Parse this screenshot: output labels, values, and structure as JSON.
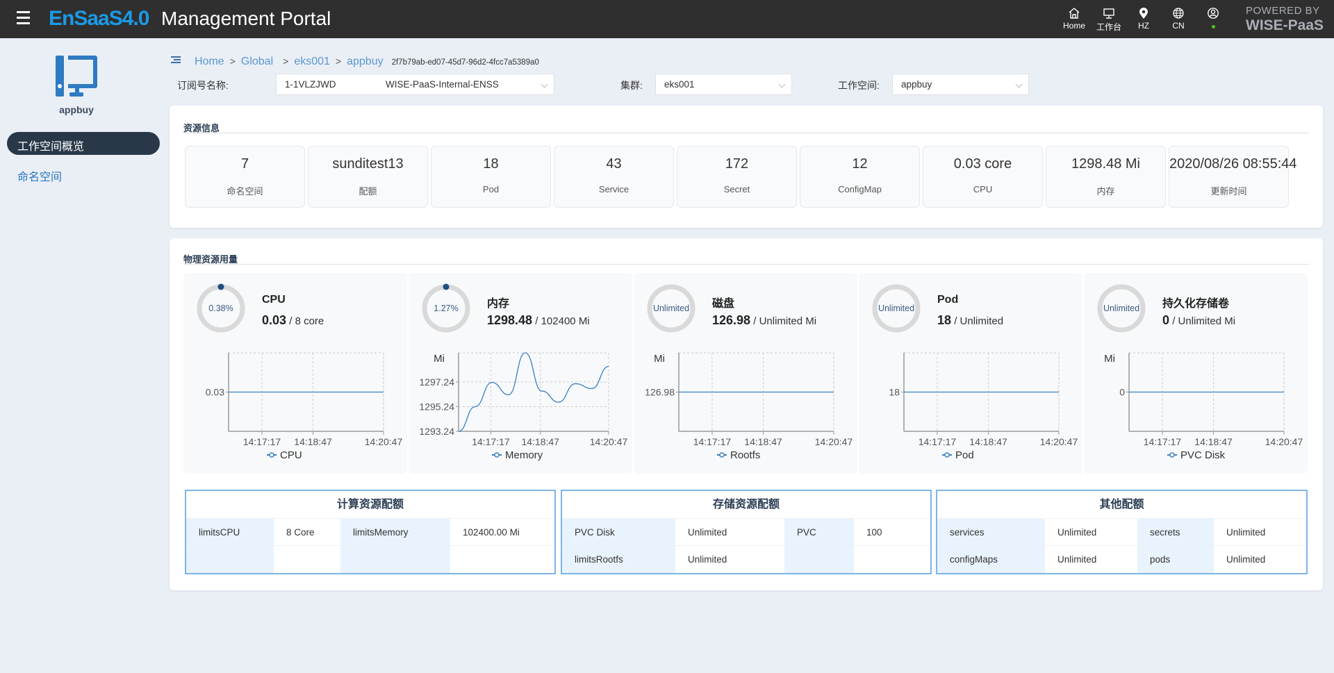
{
  "header": {
    "menu_icon": "hamburger-icon",
    "brand": "EnSaaS4.0",
    "title": "Management Portal",
    "nav": [
      {
        "icon": "home-icon",
        "label": "Home"
      },
      {
        "icon": "monitor-icon",
        "label": "工作台"
      },
      {
        "icon": "location-icon",
        "label": "HZ"
      },
      {
        "icon": "globe-icon",
        "label": "CN"
      },
      {
        "icon": "user-icon",
        "label": ""
      }
    ],
    "user_status_color": "#52c41a",
    "powered_by": "POWERED BY",
    "powered_brand": "WISE-PaaS"
  },
  "sidebar": {
    "workspace_icon": "computer-icon",
    "workspace_name": "appbuy",
    "items": [
      {
        "label": "工作空间概览",
        "active": true
      },
      {
        "label": "命名空间",
        "active": false
      }
    ]
  },
  "breadcrumb": {
    "items": [
      "Home",
      "Global",
      "eks001",
      "appbuy"
    ],
    "separator": ">",
    "uuid": "2f7b79ab-ed07-45d7-96d2-4fcc7a5389a0"
  },
  "filters": {
    "subscription": {
      "label": "订阅号名称:",
      "id": "1-1VLZJWD",
      "name": "WISE-PaaS-Internal-ENSS"
    },
    "cluster": {
      "label": "集群:",
      "value": "eks001"
    },
    "workspace": {
      "label": "工作空间:",
      "value": "appbuy"
    }
  },
  "resource_info": {
    "title": "资源信息",
    "stats": [
      {
        "value": "7",
        "label": "命名空间"
      },
      {
        "value": "sunditest13",
        "label": "配额"
      },
      {
        "value": "18",
        "label": "Pod"
      },
      {
        "value": "43",
        "label": "Service"
      },
      {
        "value": "172",
        "label": "Secret"
      },
      {
        "value": "12",
        "label": "ConfigMap"
      },
      {
        "value": "0.03 core",
        "label": "CPU"
      },
      {
        "value": "1298.48 Mi",
        "label": "内存"
      },
      {
        "value": "2020/08/26 08:55:44",
        "label": "更新时间"
      }
    ]
  },
  "physical_usage": {
    "title": "物理资源用量",
    "panels": [
      {
        "ring_label": "0.38%",
        "percent": 0.38,
        "title": "CPU",
        "used": "0.03",
        "total": "8 core"
      },
      {
        "ring_label": "1.27%",
        "percent": 1.27,
        "title": "内存",
        "used": "1298.48",
        "total": "102400 Mi"
      },
      {
        "ring_label": "Unlimited",
        "percent": null,
        "title": "磁盘",
        "used": "126.98",
        "total": "Unlimited Mi"
      },
      {
        "ring_label": "Unlimited",
        "percent": null,
        "title": "Pod",
        "used": "18",
        "total": "Unlimited"
      },
      {
        "ring_label": "Unlimited",
        "percent": null,
        "title": "持久化存储卷",
        "used": "0",
        "total": "Unlimited Mi"
      }
    ]
  },
  "chart_data": [
    {
      "type": "line",
      "title": "",
      "xlabel": "",
      "ylabel": "",
      "x_ticks": [
        "14:17:17",
        "14:18:47",
        "14:20:47"
      ],
      "y_ticks": [
        "0.03"
      ],
      "ylim": [
        0,
        0.06
      ],
      "series": [
        {
          "name": "CPU",
          "values": [
            0.03,
            0.03,
            0.03,
            0.03,
            0.03,
            0.03,
            0.03,
            0.03,
            0.03,
            0.03
          ]
        }
      ],
      "legend": "bottom"
    },
    {
      "type": "line",
      "title": "",
      "xlabel": "",
      "ylabel": "Mi",
      "x_ticks": [
        "14:17:17",
        "14:18:47",
        "14:20:47"
      ],
      "y_ticks": [
        "1293.24",
        "1295.24",
        "1297.24"
      ],
      "ylim": [
        1293.24,
        1299.6
      ],
      "series": [
        {
          "name": "Memory",
          "values": [
            1293.24,
            1295.24,
            1297.2,
            1296.2,
            1299.6,
            1296.5,
            1295.6,
            1297.1,
            1296.7,
            1298.5
          ]
        }
      ],
      "legend": "bottom"
    },
    {
      "type": "line",
      "title": "",
      "xlabel": "",
      "ylabel": "Mi",
      "x_ticks": [
        "14:17:17",
        "14:18:47",
        "14:20:47"
      ],
      "y_ticks": [
        "126.98"
      ],
      "ylim": [
        0,
        253.96
      ],
      "series": [
        {
          "name": "Rootfs",
          "values": [
            126.98,
            126.98,
            126.98,
            126.98,
            126.98,
            126.98,
            126.98,
            126.98,
            126.98,
            126.98
          ]
        }
      ],
      "legend": "bottom"
    },
    {
      "type": "line",
      "title": "",
      "xlabel": "",
      "ylabel": "",
      "x_ticks": [
        "14:17:17",
        "14:18:47",
        "14:20:47"
      ],
      "y_ticks": [
        "18"
      ],
      "ylim": [
        0,
        36
      ],
      "series": [
        {
          "name": "Pod",
          "values": [
            18,
            18,
            18,
            18,
            18,
            18,
            18,
            18,
            18,
            18
          ]
        }
      ],
      "legend": "bottom"
    },
    {
      "type": "line",
      "title": "",
      "xlabel": "",
      "ylabel": "Mi",
      "x_ticks": [
        "14:17:17",
        "14:18:47",
        "14:20:47"
      ],
      "y_ticks": [
        "0"
      ],
      "ylim": [
        -1,
        1
      ],
      "series": [
        {
          "name": "PVC Disk",
          "values": [
            0,
            0,
            0,
            0,
            0,
            0,
            0,
            0,
            0,
            0
          ]
        }
      ],
      "legend": "bottom"
    }
  ],
  "quotas": [
    {
      "title": "计算资源配额",
      "rows": [
        [
          "limitsCPU",
          "8 Core",
          "limitsMemory",
          "102400.00 Mi"
        ],
        [
          "",
          "",
          "",
          ""
        ]
      ]
    },
    {
      "title": "存储资源配额",
      "rows": [
        [
          "PVC Disk",
          "Unlimited",
          "PVC",
          "100"
        ],
        [
          "limitsRootfs",
          "Unlimited",
          "",
          ""
        ]
      ]
    },
    {
      "title": "其他配额",
      "rows": [
        [
          "services",
          "Unlimited",
          "secrets",
          "Unlimited"
        ],
        [
          "configMaps",
          "Unlimited",
          "pods",
          "Unlimited"
        ]
      ]
    }
  ],
  "colors": {
    "accent": "#1a9ae6",
    "line": "#3a7fc1",
    "ring_track": "#d9d9d9",
    "ring_fill": "#1f4e80",
    "nav_active_bg": "#283848",
    "quota_border": "#7db4e6"
  }
}
